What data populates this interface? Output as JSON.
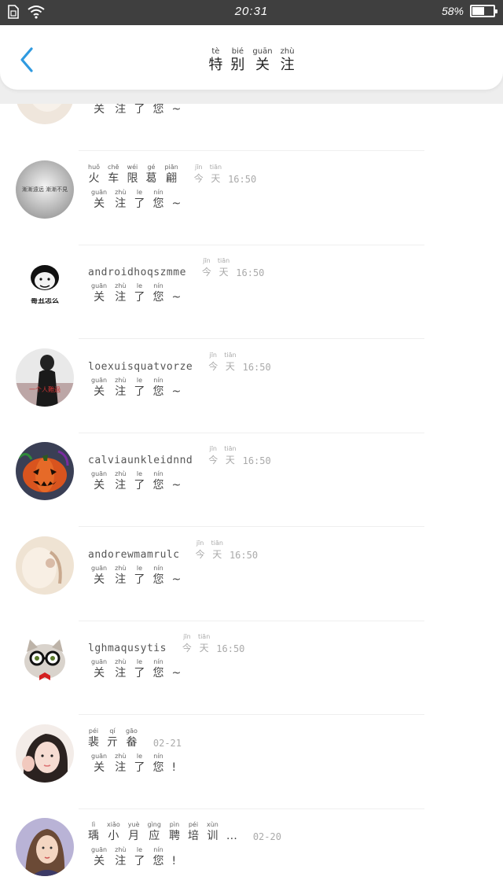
{
  "status": {
    "time": "20:31",
    "battery": "58%",
    "battery_level": 0.58
  },
  "header": {
    "title": [
      {
        "py": "tè",
        "hz": "特"
      },
      {
        "py": "bié",
        "hz": "别"
      },
      {
        "py": "guān",
        "hz": "关"
      },
      {
        "py": "zhù",
        "hz": "注"
      }
    ]
  },
  "msg_follow": [
    {
      "py": "guān",
      "hz": "关"
    },
    {
      "py": "zhù",
      "hz": "注"
    },
    {
      "py": "le",
      "hz": "了"
    },
    {
      "py": "nín",
      "hz": "您"
    }
  ],
  "today": [
    {
      "py": "jīn",
      "hz": "今"
    },
    {
      "py": "tiān",
      "hz": "天"
    }
  ],
  "items": [
    {
      "name_latin": "",
      "time": "",
      "suffix": "~"
    },
    {
      "name_chars": [
        {
          "py": "huǒ",
          "hz": "火"
        },
        {
          "py": "chē",
          "hz": "车"
        },
        {
          "py": "wéi",
          "hz": "限"
        },
        {
          "py": "gé",
          "hz": "葛"
        },
        {
          "py": "piān",
          "hz": "翩"
        }
      ],
      "time": "16:50",
      "suffix": "~"
    },
    {
      "name_latin": "androidhoqszmme",
      "time": "16:50",
      "suffix": "~"
    },
    {
      "name_latin": "loexuisquatvorze",
      "time": "16:50",
      "suffix": "~"
    },
    {
      "name_latin": "calviaunkleidnnd",
      "time": "16:50",
      "suffix": "~"
    },
    {
      "name_latin": "andorewmamrulc",
      "time": "16:50",
      "suffix": "~"
    },
    {
      "name_latin": "lghmaqusytis",
      "time": "16:50",
      "suffix": "~"
    },
    {
      "name_chars": [
        {
          "py": "péi",
          "hz": "裴"
        },
        {
          "py": "qí",
          "hz": "亓"
        },
        {
          "py": "gāo",
          "hz": "畚"
        }
      ],
      "time": "02-21",
      "suffix": "!"
    },
    {
      "name_chars": [
        {
          "py": "lì",
          "hz": "瑀"
        },
        {
          "py": "xiǎo",
          "hz": "小"
        },
        {
          "py": "yuè",
          "hz": "月"
        },
        {
          "py": "gìng",
          "hz": "应"
        },
        {
          "py": "pìn",
          "hz": "聘"
        },
        {
          "py": "péi",
          "hz": "培"
        },
        {
          "py": "xùn",
          "hz": "训"
        }
      ],
      "name_suffix": "…",
      "time": "02-20",
      "suffix": "!"
    }
  ],
  "avatar_text": {
    "item1": "漸漸遠远 漸漸不見",
    "item2": "哥丑怎么",
    "item3": "一个人難過"
  }
}
